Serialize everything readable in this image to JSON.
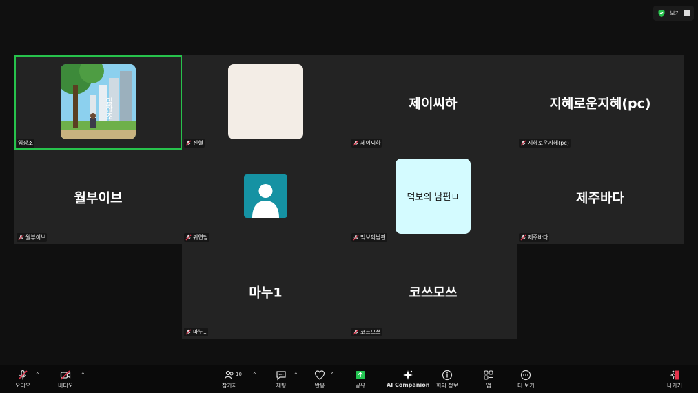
{
  "topbar": {
    "view_label": "보기"
  },
  "tiles": {
    "t1": {
      "name": "임장조"
    },
    "t2": {
      "name": "진혈"
    },
    "t3": {
      "name": "제이씨하",
      "display": "제이씨하"
    },
    "t4": {
      "name": "지혜로운지혜(pc)",
      "display": "지혜로운지혜(pc)"
    },
    "t5": {
      "name": "월부이브",
      "display": "월부이브"
    },
    "t6": {
      "name": "귀연당"
    },
    "t7": {
      "name": "먹보의남편",
      "avatar_text": "먹보의 남편ㅂ"
    },
    "t8": {
      "name": "제주바다",
      "display": "제주바다"
    },
    "t9": {
      "name": "마누1",
      "display": "마누1"
    },
    "t10": {
      "name": "코쓰모쓰",
      "display": "코쓰모쓰"
    }
  },
  "art": {
    "text": "임장조"
  },
  "toolbar": {
    "audio": "오디오",
    "video": "비디오",
    "participants": "참가자",
    "participants_count": "10",
    "chat": "채팅",
    "reactions": "반응",
    "share": "공유",
    "ai": "AI Companion",
    "info": "회의 정보",
    "apps": "앱",
    "more": "더 보기",
    "leave": "나가기"
  },
  "colors": {
    "active_border": "#27c24c",
    "share_green": "#23c552",
    "leave_red": "#e2334b"
  }
}
